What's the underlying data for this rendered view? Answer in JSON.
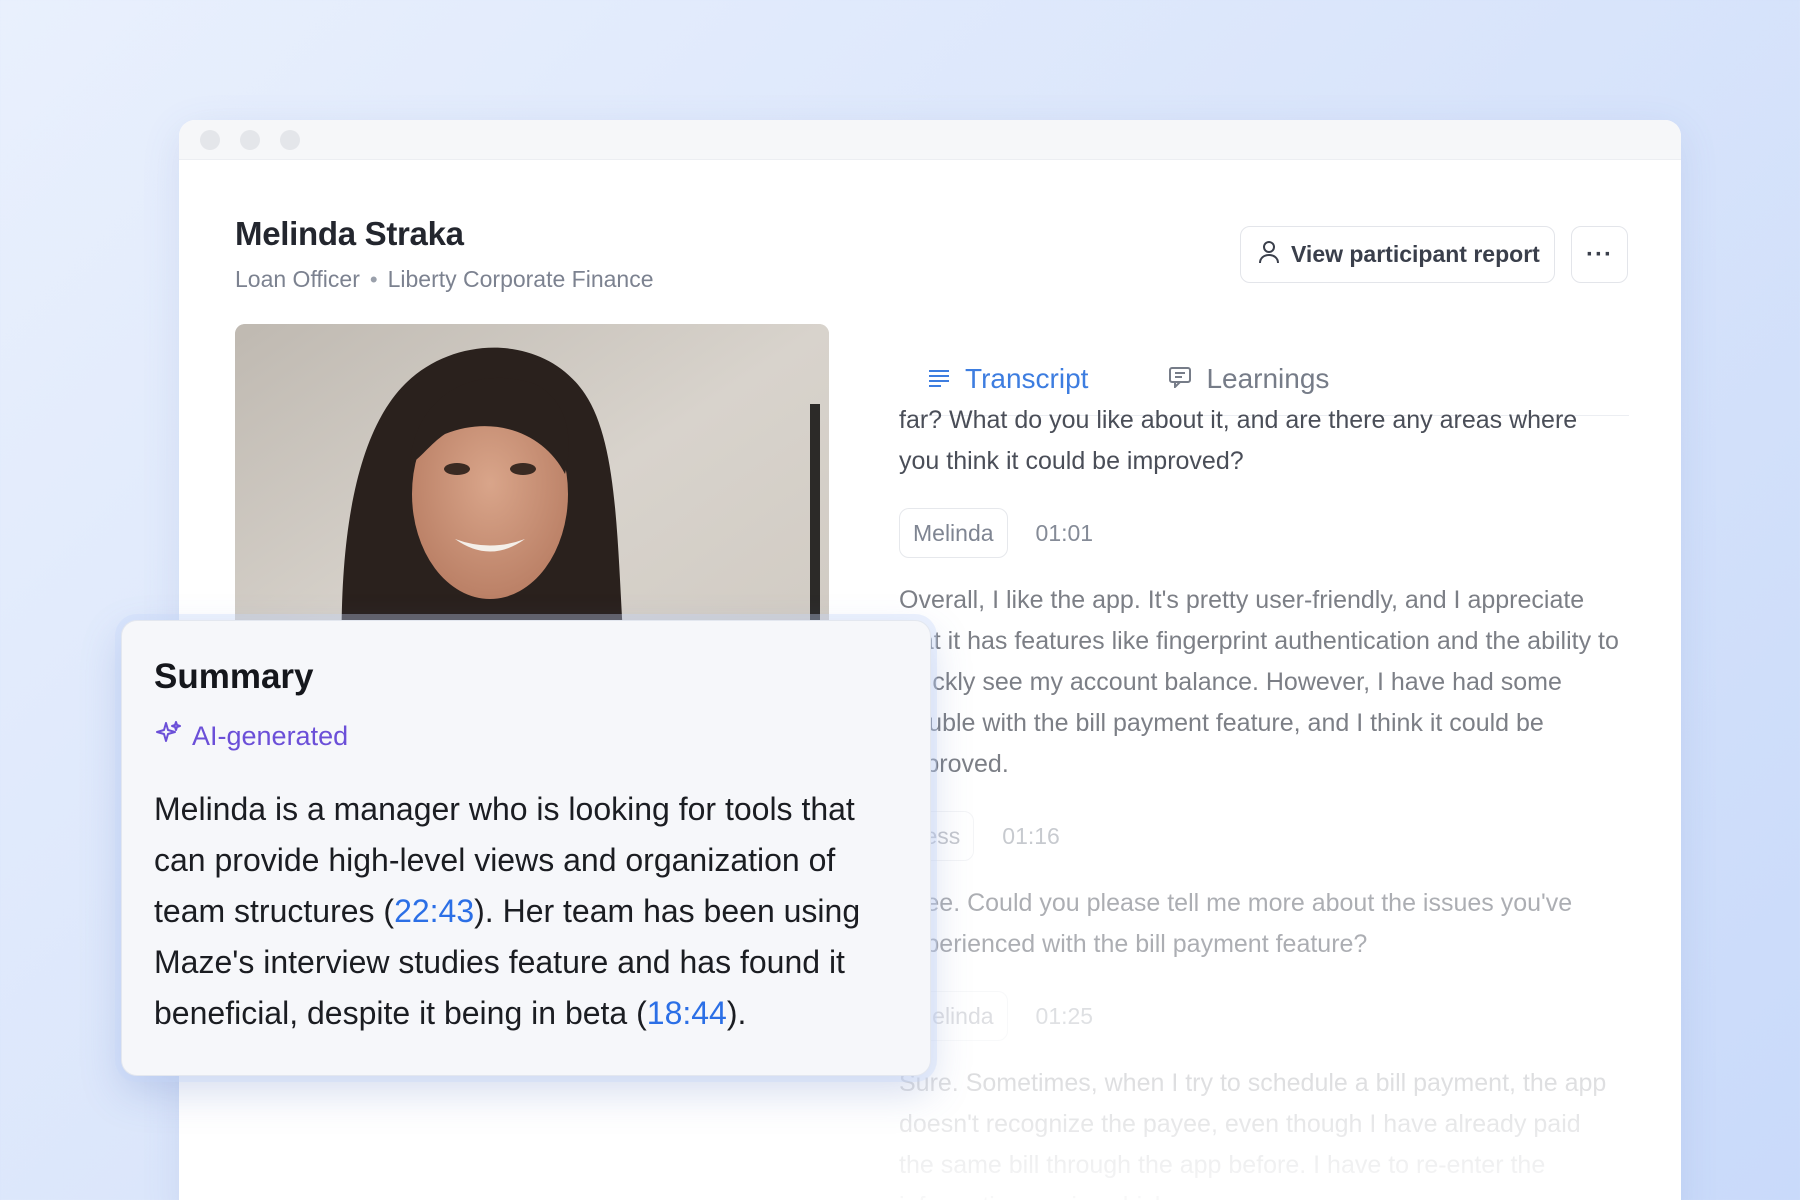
{
  "participant": {
    "name": "Melinda Straka",
    "role": "Loan Officer",
    "separator": "•",
    "company": "Liberty Corporate Finance"
  },
  "header": {
    "report_button_label": "View participant report",
    "more_button_label": "···"
  },
  "tabs": [
    {
      "label": "Transcript",
      "icon": "transcript-lines-icon",
      "active": true
    },
    {
      "label": "Learnings",
      "icon": "chat-bubble-icon",
      "active": false
    }
  ],
  "transcript": {
    "intro_text": "far? What do you like about it, and are there any areas where you think it could be improved?",
    "entries": [
      {
        "speaker": "Melinda",
        "time": "01:01",
        "text": "Overall, I like the app. It's pretty user-friendly, and I appreciate that it has features like fingerprint authentication and the ability to quickly see my account balance. However, I have had some trouble with the bill payment feature, and I think it could be improved."
      },
      {
        "speaker": "Jess",
        "time": "01:16",
        "text": "I see. Could you please tell me more about the issues you've experienced with the bill payment feature?"
      },
      {
        "speaker": "Melinda",
        "time": "01:25",
        "text": "Sure. Sometimes, when I try to schedule a bill payment, the app doesn't recognize the payee, even though I have already paid the same bill through the app before. I have to re-enter the information again, which can"
      }
    ]
  },
  "summary": {
    "title": "Summary",
    "ai_label": "AI-generated",
    "text_part1": "Melinda is a manager who is looking for tools that can provide high-level views and organization of team structures (",
    "timestamp1": "22:43",
    "text_part2": "). Her team has been using Maze's interview studies feature and has found it beneficial, despite it being in beta (",
    "timestamp2": "18:44",
    "text_part3": ")."
  },
  "colors": {
    "accent_blue": "#3d7de0",
    "link_blue": "#2b6fe6",
    "ai_purple": "#6b4fd8"
  }
}
